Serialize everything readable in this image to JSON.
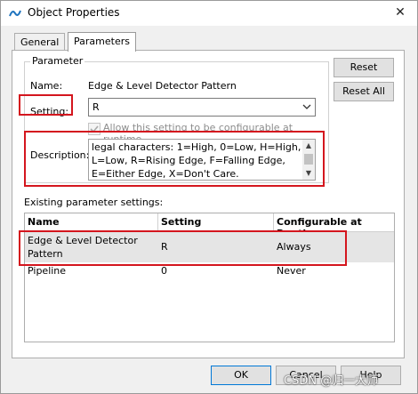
{
  "window": {
    "title": "Object Properties",
    "close_glyph": "✕"
  },
  "tabs": [
    {
      "label": "General"
    },
    {
      "label": "Parameters"
    }
  ],
  "parameter_group": {
    "label": "Parameter",
    "name_label": "Name:",
    "name_value": "Edge & Level Detector Pattern",
    "setting_label": "Setting:",
    "setting_value": "R",
    "runtime_checkbox_label": "Allow this setting to be configurable at runtime",
    "runtime_checked": true,
    "description_label": "Description:",
    "description_lines": [
      "legal characters: 1=High, 0=Low, H=High,",
      "L=Low, R=Rising Edge, F=Falling Edge,",
      "E=Either Edge, X=Don't Care."
    ]
  },
  "side_buttons": {
    "reset": "Reset",
    "reset_all": "Reset All"
  },
  "existing": {
    "label": "Existing parameter settings:",
    "columns": [
      "Name",
      "Setting",
      "Configurable at Runtime"
    ],
    "rows": [
      {
        "name_line1": "Edge & Level Detector",
        "name_line2": "Pattern",
        "setting": "R",
        "runtime": "Always"
      },
      {
        "name_line1": "Pipeline",
        "name_line2": "",
        "setting": "0",
        "runtime": "Never"
      }
    ]
  },
  "footer": {
    "ok": "OK",
    "cancel": "Cancel",
    "help": "Help"
  },
  "watermark": "CSDN @归一大师",
  "colors": {
    "highlight_red": "#d4161e",
    "selected_row": "#e5e5e5"
  }
}
